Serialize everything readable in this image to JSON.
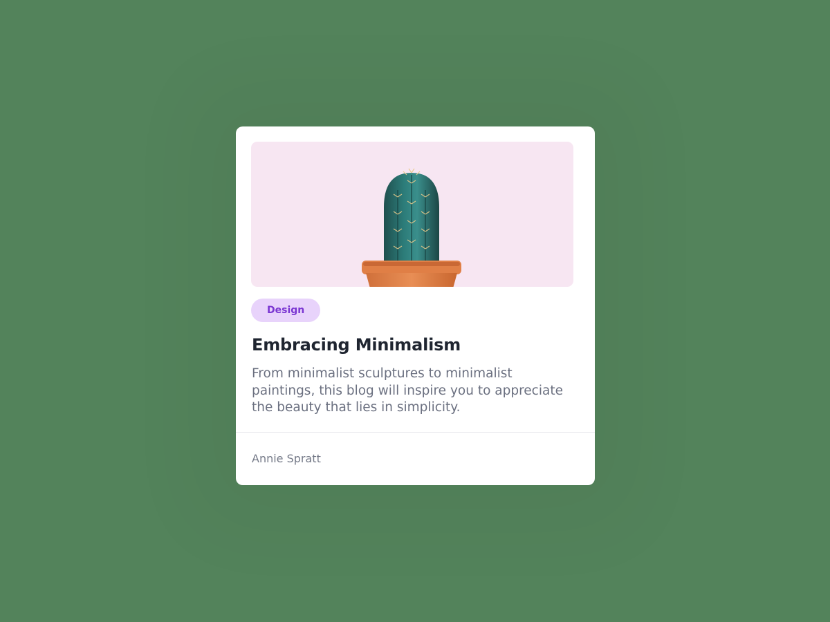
{
  "card": {
    "image": {
      "subject": "potted cactus",
      "background_color": "#f7e6f2"
    },
    "tag": {
      "label": "Design",
      "background_color": "#e8d3fb",
      "text_color": "#7a35d2"
    },
    "title": "Embracing Minimalism",
    "description": "From minimalist sculptures to minimalist paintings, this blog will inspire you to appreciate the beauty that lies in simplicity.",
    "author": "Annie Spratt"
  },
  "colors": {
    "page_background": "#53835b",
    "card_background": "#ffffff",
    "title_color": "#1f2530",
    "body_text_color": "#6b7080"
  }
}
